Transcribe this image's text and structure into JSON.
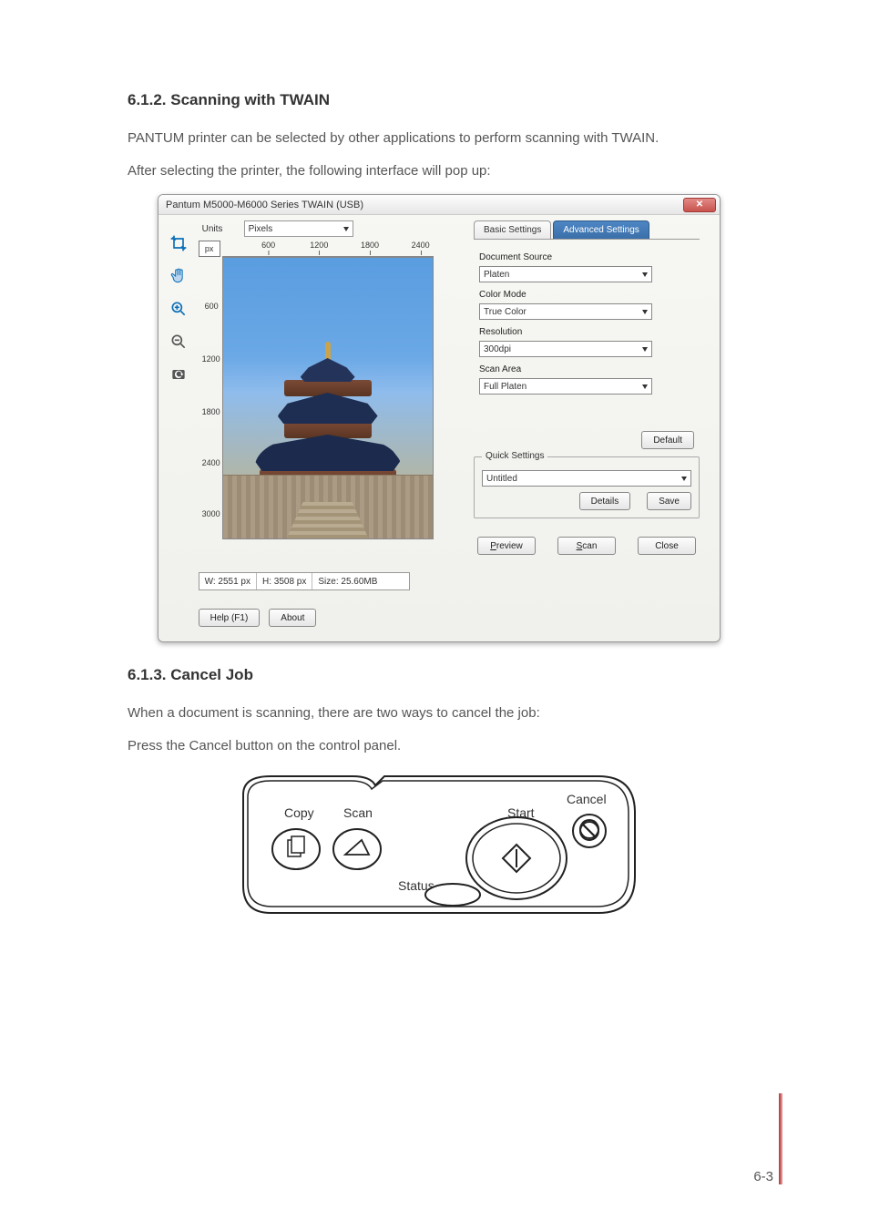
{
  "section612_heading": "6.1.2. Scanning with TWAIN",
  "para1": "PANTUM printer can be selected by other applications to perform scanning with TWAIN.",
  "para2": "After selecting the printer, the following interface will pop up:",
  "twain": {
    "window_title": "Pantum M5000-M6000 Series TWAIN (USB)",
    "close_glyph": "✕",
    "units_label": "Units",
    "units_value": "Pixels",
    "ruler_unit": "px",
    "h_ticks": [
      "600",
      "1200",
      "1800",
      "2400"
    ],
    "v_ticks": [
      "600",
      "1200",
      "1800",
      "2400",
      "3000"
    ],
    "status_w": "W:  2551 px",
    "status_h": "H:  3508 px",
    "status_size": "Size: 25.60MB",
    "help_btn": "Help (F1)",
    "about_btn": "About",
    "tabs": {
      "basic": "Basic Settings",
      "advanced": "Advanced Settings"
    },
    "labels": {
      "doc_source": "Document Source",
      "color_mode": "Color Mode",
      "resolution": "Resolution",
      "scan_area": "Scan Area"
    },
    "values": {
      "doc_source": "Platen",
      "color_mode": "True Color",
      "resolution": "300dpi",
      "scan_area": "Full Platen"
    },
    "default_btn": "Default",
    "quick_settings_legend": "Quick Settings",
    "quick_settings_value": "Untitled",
    "details_btn": "Details",
    "save_btn": "Save",
    "preview_btn_u": "P",
    "preview_btn_rest": "review",
    "scan_btn_u": "S",
    "scan_btn_rest": "can",
    "close_btn_label": "Close"
  },
  "section613_heading": "6.1.3. Cancel Job",
  "para3": "When a document is scanning, there are two ways to cancel the job:",
  "para4": "Press the Cancel button on the control panel.",
  "panel": {
    "copy": "Copy",
    "scan": "Scan",
    "status": "Status",
    "start": "Start",
    "cancel": "Cancel"
  },
  "page_number": "6-3"
}
